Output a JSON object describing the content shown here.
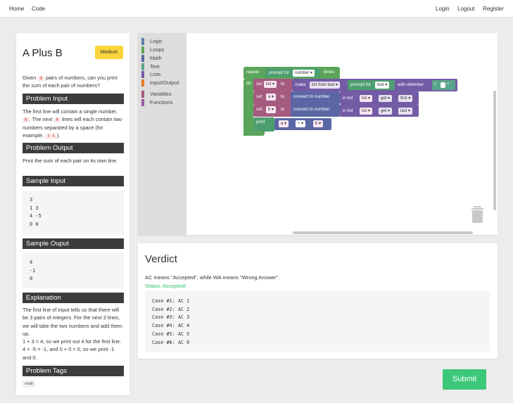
{
  "nav": {
    "home": "Home",
    "code": "Code",
    "login": "Login",
    "logout": "Logout",
    "register": "Register"
  },
  "problem": {
    "title": "A Plus B",
    "difficulty": "Medium",
    "intro_a": "Given",
    "intro_chip": "N",
    "intro_b": "pairs of numbers, can you print the sum of each pair of numbers?",
    "input_header": "Problem Input",
    "input_a": "The first line will contain a single number,",
    "input_chip1": "N",
    "input_b": ". The next",
    "input_chip2": "N",
    "input_c": "lines will each contain two numbers separated by a space (for example,",
    "input_chip3": "3 5",
    "input_d": ").",
    "output_header": "Problem Output",
    "output_text": "Print the sum of each pair on its own line.",
    "sample_input_header": "Sample Input",
    "sample_input": "3\n1 3\n4 -5\n0 0",
    "sample_output_header": "Sample Ouput",
    "sample_output": "4\n-1\n0",
    "explanation_header": "Explanation",
    "explanation_1": "The first line of input tells us that there will be 3 pairs of integers. For the next 3 lines, we will take the two numbers and add them up.",
    "explanation_2": "1 + 3 = 4, so we print out 4 for the first line. 4 + -5 = -1, and 0 + 0 = 0, so we print -1 and 0.",
    "tags_header": "Problem Tags",
    "tag": "math"
  },
  "toolbox": {
    "categories": [
      {
        "label": "Logic",
        "color": "#5b80a5"
      },
      {
        "label": "Loops",
        "color": "#5ba55b"
      },
      {
        "label": "Math",
        "color": "#5b67a5"
      },
      {
        "label": "Text",
        "color": "#5ba58c"
      },
      {
        "label": "Lists",
        "color": "#745ba5"
      },
      {
        "label": "Input/Output",
        "color": "#e07b2a"
      },
      {
        "label": "Variables",
        "color": "#a55b80"
      },
      {
        "label": "Functions",
        "color": "#995ba5"
      }
    ]
  },
  "blocks": {
    "repeat": "repeat",
    "prompt_for": "prompt for",
    "number": "number ▾",
    "times": "times",
    "do": "do",
    "set": "set",
    "list_var": "list ▾",
    "to": "to",
    "make": "make",
    "list_from_text": "list from text ▾",
    "prompt_for2": "prompt for",
    "text_type": "text ▾",
    "with_delimiter": "with delimiter",
    "quote_open": "“",
    "quote_close": "”",
    "set_a": "set",
    "a_var": "a ▾",
    "to_a": "to",
    "convert_a": "convert to number",
    "in_list_a": "in list",
    "list_a": "list ▾",
    "get_a": "get ▾",
    "first": "first ▾",
    "set_b": "set",
    "b_var": "b ▾",
    "to_b": "to",
    "convert_b": "convert to number",
    "in_list_b": "in list",
    "list_b": "list ▾",
    "get_b": "get ▾",
    "last": "last ▾",
    "print": "print",
    "a_ref": "a ▾",
    "plus": "+ ▾",
    "b_ref": "b ▾"
  },
  "verdict": {
    "title": "Verdict",
    "description": "AC means \"Accepted\", while WA means \"Wrong Answer\".",
    "status": "Status: Accepted!",
    "cases": "Case #1: AC 1\nCase #2: AC 2\nCase #3: AC 3\nCase #4: AC 4\nCase #5: AC 5\nCase #6: AC 0"
  },
  "submit_label": "Submit"
}
